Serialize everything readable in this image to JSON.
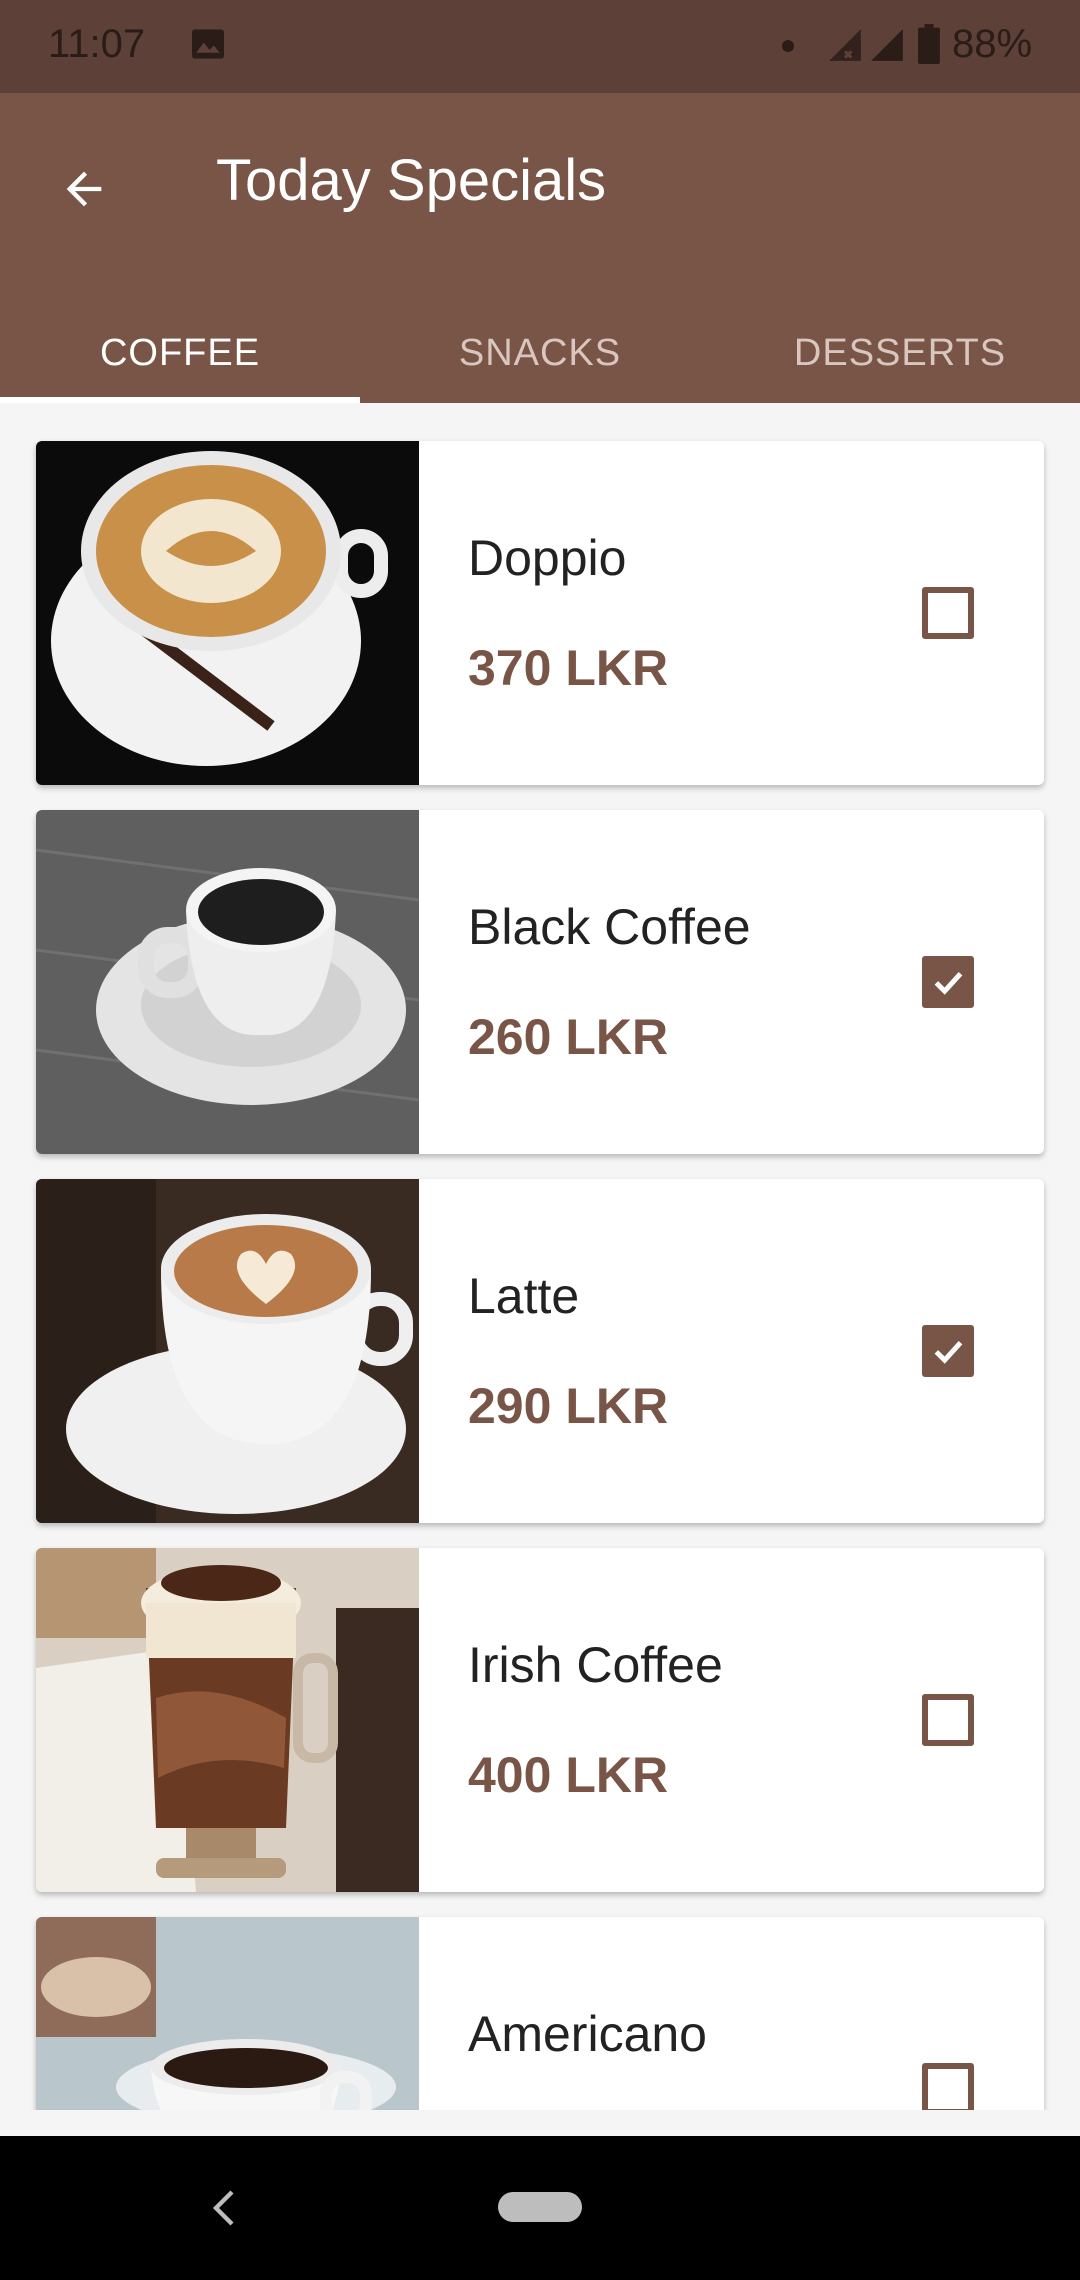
{
  "status_bar": {
    "time": "11:07",
    "battery_percent": "88%",
    "icons": [
      "gallery-icon",
      "signal-icon",
      "battery-icon"
    ]
  },
  "app_bar": {
    "title": "Today Specials",
    "back_icon": "arrow-left-icon"
  },
  "tabs": [
    {
      "label": "COFFEE",
      "active": true
    },
    {
      "label": "SNACKS",
      "active": false
    },
    {
      "label": "DESSERTS",
      "active": false
    }
  ],
  "items": [
    {
      "name": "Doppio",
      "price": "370 LKR",
      "checked": false
    },
    {
      "name": "Black Coffee",
      "price": "260 LKR",
      "checked": true
    },
    {
      "name": "Latte",
      "price": "290 LKR",
      "checked": true
    },
    {
      "name": "Irish Coffee",
      "price": "400 LKR",
      "checked": false
    },
    {
      "name": "Americano",
      "price": "",
      "checked": false
    }
  ],
  "colors": {
    "primary": "#795548",
    "primary_dark": "#5d4037",
    "accent": "#795548"
  }
}
